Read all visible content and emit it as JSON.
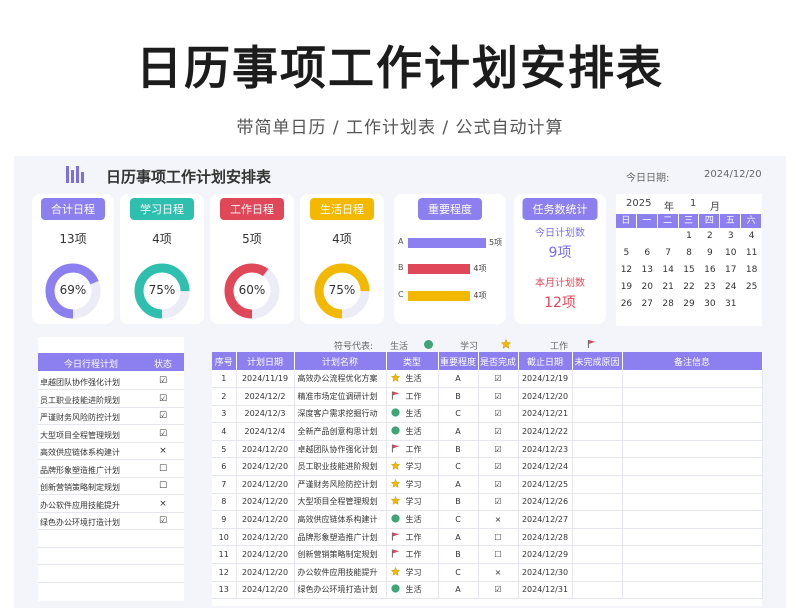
{
  "page": {
    "main_title": "日历事项工作计划安排表",
    "subtitle": "带简单日历 / 工作计划表 / 公式自动计算"
  },
  "sheet": {
    "title": "日历事项工作计划安排表",
    "today_label": "今日日期:",
    "today_value": "2024/12/20"
  },
  "cards": [
    {
      "tag": "合计日程",
      "count": "13项",
      "percent_label": "69%",
      "fraction": 0.69,
      "color": "#8c7ff0"
    },
    {
      "tag": "学习日程",
      "count": "4项",
      "percent_label": "75%",
      "fraction": 0.75,
      "color": "#2fbfae"
    },
    {
      "tag": "工作日程",
      "count": "5项",
      "percent_label": "60%",
      "fraction": 0.6,
      "color": "#e0485a"
    },
    {
      "tag": "生活日程",
      "count": "4项",
      "percent_label": "75%",
      "fraction": 0.75,
      "color": "#f3b800"
    }
  ],
  "importance": {
    "tag": "重要程度",
    "rows": [
      {
        "letter": "A",
        "value": 5,
        "label": "5项",
        "color": "#8c7ff0"
      },
      {
        "letter": "B",
        "value": 4,
        "label": "4项",
        "color": "#e0485a"
      },
      {
        "letter": "C",
        "value": 4,
        "label": "4项",
        "color": "#f3b800"
      }
    ]
  },
  "task_stats": {
    "tag": "任务数统计",
    "today_label": "今日计划数",
    "today_value": "9项",
    "month_label": "本月计划数",
    "month_value": "12项"
  },
  "calendar": {
    "year": "2025",
    "year_unit": "年",
    "month": "1",
    "month_unit": "月",
    "weekdays": [
      "日",
      "一",
      "二",
      "三",
      "四",
      "五",
      "六"
    ],
    "days": [
      "",
      "",
      "",
      "1",
      "2",
      "3",
      "4",
      "5",
      "6",
      "7",
      "8",
      "9",
      "10",
      "11",
      "12",
      "13",
      "14",
      "15",
      "16",
      "17",
      "18",
      "19",
      "20",
      "21",
      "22",
      "23",
      "24",
      "25",
      "26",
      "27",
      "28",
      "29",
      "30",
      "31",
      "",
      ""
    ]
  },
  "symbols": {
    "label": "符号代表:",
    "life": "生活",
    "study": "学习",
    "work": "工作"
  },
  "today_plan": {
    "header_title": "今日行程计划",
    "header_status": "状态",
    "items": [
      {
        "title": "卓越团队协作强化计划",
        "status": "☑"
      },
      {
        "title": "员工职业技能进阶规划",
        "status": "☑"
      },
      {
        "title": "严谨财务风险防控计划",
        "status": "☑"
      },
      {
        "title": "大型项目全程管理规划",
        "status": "☑"
      },
      {
        "title": "高效供应链体系构建计",
        "status": "×"
      },
      {
        "title": "品牌形象塑造推广计划",
        "status": "☐"
      },
      {
        "title": "创新营销策略制定规划",
        "status": "☐"
      },
      {
        "title": "办公软件应用技能提升",
        "status": "×"
      },
      {
        "title": "绿色办公环境打造计划",
        "status": "☑"
      },
      {
        "title": "",
        "status": ""
      },
      {
        "title": "",
        "status": ""
      },
      {
        "title": "",
        "status": ""
      }
    ]
  },
  "plan_table": {
    "headers": [
      "序号",
      "计划日期",
      "计划名称",
      "类型",
      "重要程度",
      "是否完成",
      "截止日期",
      "未完成原因",
      "备注信息"
    ],
    "rows": [
      {
        "no": "1",
        "date": "2024/11/19",
        "name": "高效办公流程优化方案",
        "icon": "study",
        "type": "生活",
        "level": "A",
        "done": "☑",
        "due": "2024/12/19",
        "reason": "",
        "note": ""
      },
      {
        "no": "2",
        "date": "2024/12/2",
        "name": "精准市场定位调研计划",
        "icon": "work",
        "type": "工作",
        "level": "B",
        "done": "☑",
        "due": "2024/12/20",
        "reason": "",
        "note": ""
      },
      {
        "no": "3",
        "date": "2024/12/3",
        "name": "深度客户需求挖掘行动",
        "icon": "life",
        "type": "生活",
        "level": "C",
        "done": "☑",
        "due": "2024/12/21",
        "reason": "",
        "note": ""
      },
      {
        "no": "4",
        "date": "2024/12/4",
        "name": "全新产品创意构思计划",
        "icon": "life",
        "type": "生活",
        "level": "A",
        "done": "☑",
        "due": "2024/12/22",
        "reason": "",
        "note": ""
      },
      {
        "no": "5",
        "date": "2024/12/20",
        "name": "卓越团队协作强化计划",
        "icon": "work",
        "type": "工作",
        "level": "B",
        "done": "☑",
        "due": "2024/12/23",
        "reason": "",
        "note": ""
      },
      {
        "no": "6",
        "date": "2024/12/20",
        "name": "员工职业技能进阶规划",
        "icon": "study",
        "type": "学习",
        "level": "C",
        "done": "☑",
        "due": "2024/12/24",
        "reason": "",
        "note": ""
      },
      {
        "no": "7",
        "date": "2024/12/20",
        "name": "严谨财务风险防控计划",
        "icon": "study",
        "type": "学习",
        "level": "A",
        "done": "☑",
        "due": "2024/12/25",
        "reason": "",
        "note": ""
      },
      {
        "no": "8",
        "date": "2024/12/20",
        "name": "大型项目全程管理规划",
        "icon": "study",
        "type": "学习",
        "level": "B",
        "done": "☑",
        "due": "2024/12/26",
        "reason": "",
        "note": ""
      },
      {
        "no": "9",
        "date": "2024/12/20",
        "name": "高效供应链体系构建计",
        "icon": "life",
        "type": "生活",
        "level": "C",
        "done": "×",
        "due": "2024/12/27",
        "reason": "",
        "note": ""
      },
      {
        "no": "10",
        "date": "2024/12/20",
        "name": "品牌形象塑造推广计划",
        "icon": "work",
        "type": "工作",
        "level": "A",
        "done": "☐",
        "due": "2024/12/28",
        "reason": "",
        "note": ""
      },
      {
        "no": "11",
        "date": "2024/12/20",
        "name": "创新营销策略制定规划",
        "icon": "work",
        "type": "工作",
        "level": "B",
        "done": "☐",
        "due": "2024/12/29",
        "reason": "",
        "note": ""
      },
      {
        "no": "12",
        "date": "2024/12/20",
        "name": "办公软件应用技能提升",
        "icon": "study",
        "type": "学习",
        "level": "C",
        "done": "×",
        "due": "2024/12/30",
        "reason": "",
        "note": ""
      },
      {
        "no": "13",
        "date": "2024/12/20",
        "name": "绿色办公环境打造计划",
        "icon": "life",
        "type": "生活",
        "level": "A",
        "done": "☑",
        "due": "2024/12/31",
        "reason": "",
        "note": ""
      }
    ]
  },
  "colors": {
    "accent": "#8c7ff0",
    "life": "#3fa476",
    "study": "#f3b800",
    "work": "#e0485a",
    "ring_track": "#ececf6"
  }
}
